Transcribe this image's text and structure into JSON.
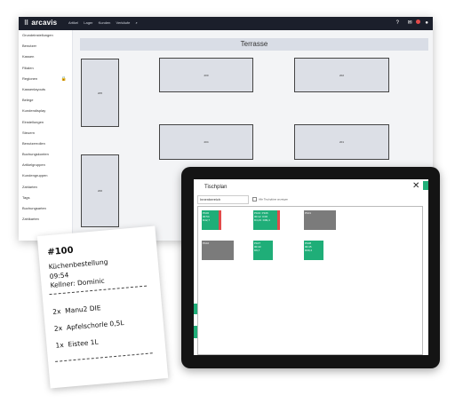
{
  "app": {
    "logo": "arcavis",
    "logo_dots": "⠿",
    "nav": [
      "Artikel",
      "Lager",
      "Kunden",
      "Verkäufe"
    ],
    "search_glyph": "⌕",
    "help_glyph": "?",
    "chat_glyph": "✉",
    "user_glyph": "●"
  },
  "sidebar": {
    "items": [
      "Grundeinstellungen",
      "Benutzer",
      "Kassen",
      "Filialen",
      "Regionen",
      "Kassenlayouts",
      "Belege",
      "Kundendisplay",
      "Einstellungen",
      "Steuern",
      "Benutzerrollen",
      "Buchungskonten",
      "Artikelgruppen",
      "Kundengruppen",
      "Zahlarten",
      "Tags",
      "Buchungsarten",
      "Zahlkarten"
    ],
    "lock_glyph": "🔒"
  },
  "room": {
    "name": "Terrasse"
  },
  "tables": [
    "205",
    "200",
    "202",
    "204",
    "201",
    "206"
  ],
  "tablet": {
    "dialog_title": "Tischplan",
    "close": "✕",
    "area_select": "Innenbereich",
    "checkbox_label": "Alle Tischpläne anzeigen",
    "tables": [
      {
        "label": "P100\n00:54\nD42,7",
        "status": "occupied"
      },
      {
        "label": "P104  P106\n00:12  0:06\nD4,23  D99,4",
        "status": "occupied"
      },
      {
        "label": "P101",
        "status": "free"
      },
      {
        "label": "P102",
        "status": "free"
      },
      {
        "label": "P107\n00:43\nD9,7",
        "status": "occupied"
      },
      {
        "label": "P108\n00:45\nD09,4",
        "status": "occupied"
      }
    ]
  },
  "receipt": {
    "number": "#100",
    "title": "Küchenbestellung",
    "time": "09:54",
    "waiter": "Kellner: Dominic",
    "items": [
      {
        "qty": "2x",
        "name": "Manu2 DIE"
      },
      {
        "qty": "2x",
        "name": "Apfelschorle 0,5L"
      },
      {
        "qty": "1x",
        "name": "Eistee 1L"
      }
    ]
  },
  "colors": {
    "occupied": "#1fae78",
    "free": "#7b7b7b",
    "topbar": "#1b1f2b"
  }
}
